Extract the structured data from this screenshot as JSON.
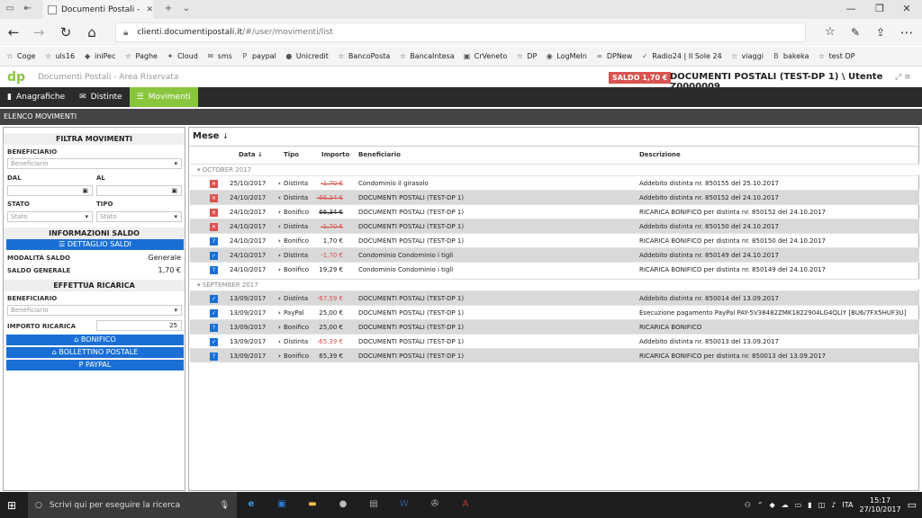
{
  "browser": {
    "tab_title": "Documenti Postali - Are",
    "url_host": "clienti.documentipostali.it",
    "url_path": "/#/user/movimenti/list",
    "favorites": [
      {
        "label": "Coge",
        "icon": "star-icon"
      },
      {
        "label": "uls16",
        "icon": "star-icon"
      },
      {
        "label": "iniPec",
        "icon": "inipec-icon"
      },
      {
        "label": "Paghe",
        "icon": "star-icon"
      },
      {
        "label": "Cloud",
        "icon": "cloud-icon"
      },
      {
        "label": "sms",
        "icon": "sms-icon"
      },
      {
        "label": "paypal",
        "icon": "paypal-icon"
      },
      {
        "label": "Unicredit",
        "icon": "unicredit-icon"
      },
      {
        "label": "BancoPosta",
        "icon": "star-icon"
      },
      {
        "label": "BancaIntesa",
        "icon": "star-icon"
      },
      {
        "label": "CrVeneto",
        "icon": "crveneto-icon"
      },
      {
        "label": "DP",
        "icon": "star-icon"
      },
      {
        "label": "LogMeIn",
        "icon": "logmein-icon"
      },
      {
        "label": "DPNew",
        "icon": "dpnew-icon"
      },
      {
        "label": "Radio24 | Il Sole 24",
        "icon": "radio24-icon"
      },
      {
        "label": "viaggi",
        "icon": "star-icon"
      },
      {
        "label": "bakeka",
        "icon": "bakeka-icon"
      },
      {
        "label": "test DP",
        "icon": "star-icon"
      }
    ]
  },
  "app": {
    "logo": "dp",
    "title": "Documenti Postali - Area Riservata",
    "saldo_badge": "SALDO 1,70 €",
    "user": "DOCUMENTI POSTALI (TEST-DP 1) \\ Utente Z0000009",
    "nav": [
      {
        "label": "Anagrafiche",
        "icon": "user-icon",
        "active": false
      },
      {
        "label": "Distinte",
        "icon": "envelope-icon",
        "active": false
      },
      {
        "label": "Movimenti",
        "icon": "list-icon",
        "active": true
      }
    ],
    "section_title": "ELENCO MOVIMENTI",
    "accent": "#8ac53e"
  },
  "filters": {
    "title": "FILTRA MOVIMENTI",
    "beneficiario_label": "BENEFICIARIO",
    "beneficiario_placeholder": "Beneficiario",
    "dal_label": "DAL",
    "al_label": "AL",
    "stato_label": "STATO",
    "stato_placeholder": "Stato",
    "tipo_label": "TIPO",
    "tipo_placeholder": "Stato"
  },
  "saldo_info": {
    "title": "INFORMAZIONI SALDO",
    "dettaglio_button": "DETTAGLIO SALDI",
    "modalita_label": "MODALITÀ SALDO",
    "modalita_value": "Generale",
    "saldo_label": "SALDO GENERALE",
    "saldo_value": "1,70 €"
  },
  "ricarica": {
    "title": "EFFETTUA RICARICA",
    "beneficiario_label": "BENEFICIARIO",
    "beneficiario_placeholder": "Beneficiario",
    "importo_label": "IMPORTO RICARICA",
    "importo_value": "25",
    "btn_bonifico": "BONIFICO",
    "btn_bollettino": "BOLLETTINO POSTALE",
    "btn_paypal": "PAYPAL"
  },
  "table": {
    "group_by": "Mese",
    "headers": {
      "data": "Data",
      "tipo": "Tipo",
      "importo": "Importo",
      "beneficiario": "Beneficiario",
      "descrizione": "Descrizione"
    },
    "groups": [
      {
        "label": "OCTOBER 2017",
        "rows": [
          {
            "status": "x",
            "data": "25/10/2017",
            "dir": "<",
            "tipo": "Distinta",
            "importo": "-1,70 €",
            "neg": true,
            "strike": true,
            "beneficiario": "Condominio il girasolo",
            "descrizione": "Addebito distinta nr. 850155 del 25.10.2017"
          },
          {
            "status": "x",
            "data": "24/10/2017",
            "dir": "<",
            "tipo": "Distinta",
            "importo": "-66,34 €",
            "neg": true,
            "strike": true,
            "beneficiario": "DOCUMENTI POSTALI (TEST-DP 1)",
            "descrizione": "Addebito distinta nr. 850152 del 24.10.2017"
          },
          {
            "status": "x",
            "data": "24/10/2017",
            "dir": ">",
            "tipo": "Bonifico",
            "importo": "66,34 €",
            "neg": false,
            "strike": true,
            "beneficiario": "DOCUMENTI POSTALI (TEST-DP 1)",
            "descrizione": "RICARICA BONIFICO per distinta nr. 850152 del 24.10.2017"
          },
          {
            "status": "x",
            "data": "24/10/2017",
            "dir": "<",
            "tipo": "Distinta",
            "importo": "-1,70 €",
            "neg": true,
            "strike": true,
            "beneficiario": "DOCUMENTI POSTALI (TEST-DP 1)",
            "descrizione": "Addebito distinta nr. 850150 del 24.10.2017"
          },
          {
            "status": "q",
            "data": "24/10/2017",
            "dir": ">",
            "tipo": "Bonifico",
            "importo": "1,70 €",
            "neg": false,
            "strike": false,
            "beneficiario": "DOCUMENTI POSTALI (TEST-DP 1)",
            "descrizione": "RICARICA BONIFICO per distinta nr. 850150 del 24.10.2017"
          },
          {
            "status": "ok",
            "data": "24/10/2017",
            "dir": "<",
            "tipo": "Distinta",
            "importo": "-1,70 €",
            "neg": true,
            "strike": false,
            "beneficiario": "Condominio Condominio i tigli",
            "descrizione": "Addebito distinta nr. 850149 del 24.10.2017"
          },
          {
            "status": "q",
            "data": "24/10/2017",
            "dir": ">",
            "tipo": "Bonifico",
            "importo": "19,29 €",
            "neg": false,
            "strike": false,
            "beneficiario": "Condominio Condominio i tigli",
            "descrizione": "RICARICA BONIFICO per distinta nr. 850149 del 24.10.2017"
          }
        ]
      },
      {
        "label": "SEPTEMBER 2017",
        "rows": [
          {
            "status": "ok",
            "data": "13/09/2017",
            "dir": "<",
            "tipo": "Distinta",
            "importo": "-67,59 €",
            "neg": true,
            "strike": false,
            "beneficiario": "DOCUMENTI POSTALI (TEST-DP 1)",
            "descrizione": "Addebito distinta nr. 850014 del 13.09.2017"
          },
          {
            "status": "ok",
            "data": "13/09/2017",
            "dir": ">",
            "tipo": "PayPal",
            "importo": "25,00 €",
            "neg": false,
            "strike": false,
            "beneficiario": "DOCUMENTI POSTALI (TEST-DP 1)",
            "descrizione": "Esecuzione pagamento PayPal PAY-5V38482ZMK1822904LG4QLIY [BU6/7FX5HUF3U]"
          },
          {
            "status": "q",
            "data": "13/09/2017",
            "dir": ">",
            "tipo": "Bonifico",
            "importo": "25,00 €",
            "neg": false,
            "strike": false,
            "beneficiario": "DOCUMENTI POSTALI (TEST-DP 1)",
            "descrizione": "RICARICA BONIFICO"
          },
          {
            "status": "ok",
            "data": "13/09/2017",
            "dir": "<",
            "tipo": "Distinta",
            "importo": "-65,39 €",
            "neg": true,
            "strike": false,
            "beneficiario": "DOCUMENTI POSTALI (TEST-DP 1)",
            "descrizione": "Addebito distinta nr. 850013 del 13.09.2017"
          },
          {
            "status": "q",
            "data": "13/09/2017",
            "dir": ">",
            "tipo": "Bonifico",
            "importo": "65,39 €",
            "neg": false,
            "strike": false,
            "beneficiario": "DOCUMENTI POSTALI (TEST-DP 1)",
            "descrizione": "RICARICA BONIFICO per distinta nr. 850013 del 13.09.2017"
          }
        ]
      }
    ]
  },
  "taskbar": {
    "search_placeholder": "Scrivi qui per eseguire la ricerca",
    "lang": "ITA",
    "time": "15:17",
    "date": "27/10/2017"
  }
}
